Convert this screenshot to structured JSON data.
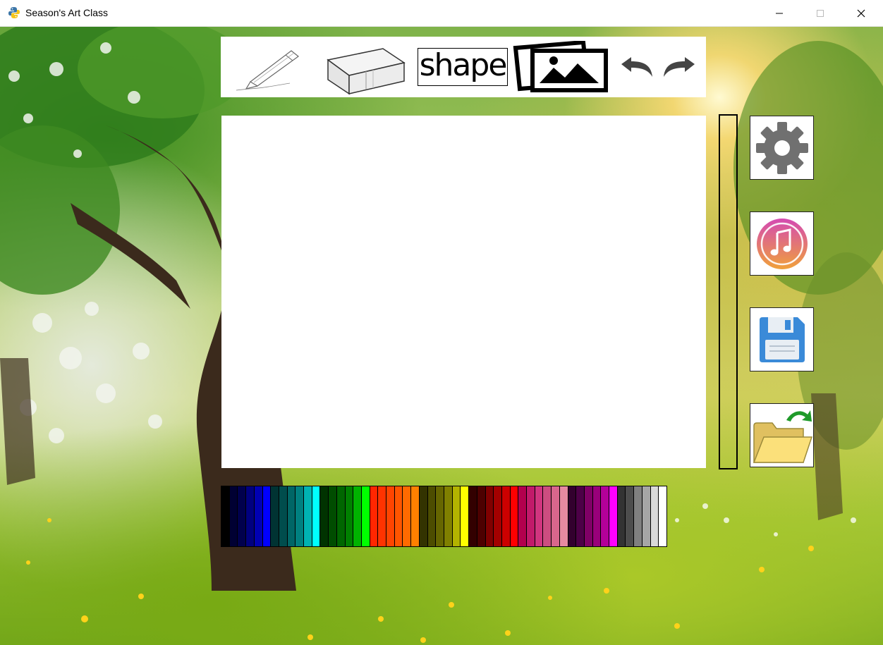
{
  "window": {
    "title": "Season's Art Class",
    "icon": "python-icon",
    "controls": [
      "minimize-icon",
      "maximize-icon",
      "close-icon"
    ]
  },
  "toolbar": {
    "tools": [
      {
        "name": "pencil",
        "icon": "pencil-icon"
      },
      {
        "name": "eraser",
        "icon": "eraser-icon"
      },
      {
        "name": "shape",
        "icon": "shape-icon",
        "label": "shape"
      },
      {
        "name": "image",
        "icon": "image-icon"
      },
      {
        "name": "undo",
        "icon": "undo-arrow-icon"
      },
      {
        "name": "redo",
        "icon": "redo-arrow-icon"
      }
    ]
  },
  "side_buttons": [
    {
      "name": "settings",
      "icon": "gear-icon"
    },
    {
      "name": "music",
      "icon": "music-note-icon"
    },
    {
      "name": "save",
      "icon": "floppy-disk-icon"
    },
    {
      "name": "open",
      "icon": "open-folder-icon"
    }
  ],
  "palette": {
    "colors": [
      "#000000",
      "#000033",
      "#00004d",
      "#000080",
      "#0000b3",
      "#0000ff",
      "#003333",
      "#004d4d",
      "#006666",
      "#008080",
      "#00b3b3",
      "#00ffff",
      "#003300",
      "#004d00",
      "#006600",
      "#008000",
      "#00b300",
      "#00ff00",
      "#ff2600",
      "#ff3300",
      "#ff4400",
      "#ff5500",
      "#ff6a00",
      "#ff8000",
      "#333300",
      "#4d4d00",
      "#666600",
      "#808000",
      "#b3b300",
      "#ffff00",
      "#330000",
      "#4d0000",
      "#800000",
      "#a30000",
      "#cc0000",
      "#ff0000",
      "#b3004d",
      "#c21a6a",
      "#d1357f",
      "#cc4d80",
      "#d9668c",
      "#e68aa0",
      "#33002e",
      "#4d0047",
      "#800066",
      "#99007a",
      "#b30099",
      "#ff00ff",
      "#333333",
      "#4d4d4d",
      "#808080",
      "#a6a6a6",
      "#d9d9d9",
      "#ffffff"
    ]
  },
  "colors": {
    "toolbar_bg": "#ffffff",
    "canvas_bg": "#ffffff",
    "slider_border": "#000000"
  }
}
